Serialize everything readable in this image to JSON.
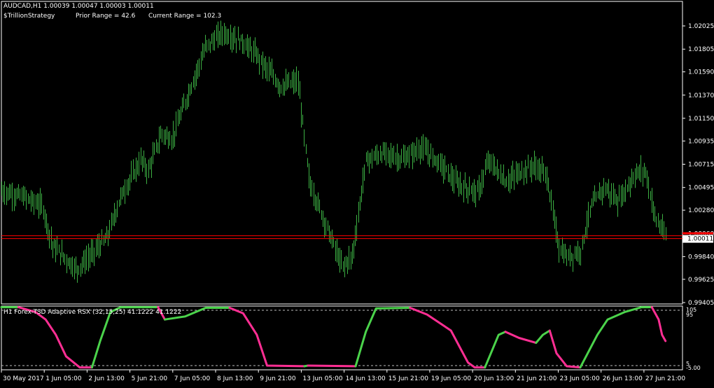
{
  "colors": {
    "background": "#000000",
    "frame": "#ffffff",
    "candle": "#3cb043",
    "level_line": "#ff0000",
    "rsx_up": "#4bd34b",
    "rsx_down": "#ff2e93",
    "level_dash": "#bbbbbb"
  },
  "header": {
    "symbol_line": "AUDCAD,H1  1.00039 1.00047 1.00003 1.00011",
    "strategy": "$TrillionStrategy",
    "prior_range": "Prior Range = 42.6",
    "current_range": "Current Range = 102.3"
  },
  "price_axis": {
    "ticks": [
      "1.02025",
      "1.01805",
      "1.01590",
      "1.01370",
      "1.01150",
      "1.00935",
      "1.00715",
      "1.00495",
      "1.00280",
      "1.00060",
      "0.99840",
      "0.99625",
      "0.99405"
    ],
    "current_price": "1.00011"
  },
  "indicator": {
    "label": "H1 Forex-TSD Adaptive RSX (32,15,25) 41.1222 41.1222",
    "upper_level_label": "95",
    "upper_range_label": "105",
    "lower_level_label": "5",
    "lower_range_label": "-5.00"
  },
  "time_axis": {
    "labels": [
      "30 May 2017",
      "1 Jun 05:00",
      "2 Jun 13:00",
      "5 Jun 21:00",
      "7 Jun 05:00",
      "8 Jun 13:00",
      "9 Jun 21:00",
      "13 Jun 05:00",
      "14 Jun 13:00",
      "15 Jun 21:00",
      "19 Jun 05:00",
      "20 Jun 13:00",
      "21 Jun 21:00",
      "23 Jun 05:00",
      "26 Jun 13:00",
      "27 Jun 21:00"
    ]
  },
  "chart_data": [
    {
      "type": "line",
      "symbol": "AUDCAD",
      "timeframe": "H1",
      "ylim": [
        0.99405,
        1.0213
      ],
      "level": 1.00011,
      "x": [
        "30 May 2017",
        "1 Jun 05:00",
        "2 Jun 13:00",
        "5 Jun 21:00",
        "7 Jun 05:00",
        "8 Jun 13:00",
        "9 Jun 21:00",
        "13 Jun 05:00",
        "14 Jun 13:00",
        "15 Jun 21:00",
        "19 Jun 05:00",
        "20 Jun 13:00",
        "21 Jun 21:00",
        "23 Jun 05:00",
        "26 Jun 13:00",
        "27 Jun 21:00"
      ],
      "close_path": [
        [
          0,
          1.0046
        ],
        [
          0.03,
          1.0041
        ],
        [
          0.06,
          1.0032
        ],
        [
          0.075,
          0.9994
        ],
        [
          0.09,
          0.9985
        ],
        [
          0.11,
          0.9972
        ],
        [
          0.13,
          0.9985
        ],
        [
          0.155,
          1.0002
        ],
        [
          0.175,
          1.0041
        ],
        [
          0.205,
          1.0076
        ],
        [
          0.215,
          1.0065
        ],
        [
          0.235,
          1.0101
        ],
        [
          0.25,
          1.0095
        ],
        [
          0.275,
          1.014
        ],
        [
          0.3,
          1.0183
        ],
        [
          0.325,
          1.0196
        ],
        [
          0.355,
          1.0187
        ],
        [
          0.375,
          1.0174
        ],
        [
          0.41,
          1.0145
        ],
        [
          0.435,
          1.015
        ],
        [
          0.452,
          1.0054
        ],
        [
          0.47,
          1.0025
        ],
        [
          0.5,
          0.9974
        ],
        [
          0.515,
          0.9985
        ],
        [
          0.535,
          1.0075
        ],
        [
          0.56,
          1.0082
        ],
        [
          0.59,
          1.0076
        ],
        [
          0.615,
          1.0087
        ],
        [
          0.64,
          1.0075
        ],
        [
          0.67,
          1.0052
        ],
        [
          0.7,
          1.0045
        ],
        [
          0.715,
          1.0075
        ],
        [
          0.74,
          1.0055
        ],
        [
          0.765,
          1.0065
        ],
        [
          0.78,
          1.007
        ],
        [
          0.8,
          1.0062
        ],
        [
          0.818,
          0.9993
        ],
        [
          0.83,
          0.9983
        ],
        [
          0.85,
          0.999
        ],
        [
          0.865,
          1.0031
        ],
        [
          0.885,
          1.005
        ],
        [
          0.905,
          1.0036
        ],
        [
          0.93,
          1.0062
        ],
        [
          0.945,
          1.0066
        ],
        [
          0.96,
          1.002
        ],
        [
          0.975,
          1.0003
        ]
      ]
    },
    {
      "type": "line",
      "title": "H1 Forex-TSD Adaptive RSX (32,15,25) 41.1222 41.1222",
      "ylim": [
        -5,
        105
      ],
      "levels": [
        95,
        5
      ],
      "x": [
        "30 May 2017",
        "1 Jun 05:00",
        "2 Jun 13:00",
        "5 Jun 21:00",
        "7 Jun 05:00",
        "8 Jun 13:00",
        "9 Jun 21:00",
        "13 Jun 05:00",
        "14 Jun 13:00",
        "15 Jun 21:00",
        "19 Jun 05:00",
        "20 Jun 13:00",
        "21 Jun 21:00",
        "23 Jun 05:00",
        "26 Jun 13:00",
        "27 Jun 21:00"
      ],
      "series": [
        {
          "trend": "up",
          "points": [
            [
              0,
              100
            ],
            [
              0.025,
              100
            ]
          ]
        },
        {
          "trend": "down",
          "points": [
            [
              0.025,
              100
            ],
            [
              0.05,
              92
            ],
            [
              0.065,
              80
            ],
            [
              0.08,
              55
            ],
            [
              0.095,
              20
            ],
            [
              0.115,
              2
            ],
            [
              0.133,
              2
            ]
          ]
        },
        {
          "trend": "up",
          "points": [
            [
              0.133,
              2
            ],
            [
              0.145,
              45
            ],
            [
              0.16,
              92
            ],
            [
              0.175,
              100
            ],
            [
              0.23,
              100
            ]
          ]
        },
        {
          "trend": "down",
          "points": [
            [
              0.23,
              100
            ],
            [
              0.24,
              80
            ]
          ]
        },
        {
          "trend": "up",
          "points": [
            [
              0.24,
              80
            ],
            [
              0.27,
              85
            ],
            [
              0.3,
              99
            ],
            [
              0.335,
              99
            ]
          ]
        },
        {
          "trend": "down",
          "points": [
            [
              0.335,
              99
            ],
            [
              0.355,
              90
            ],
            [
              0.375,
              55
            ],
            [
              0.39,
              5
            ],
            [
              0.445,
              4
            ]
          ]
        },
        {
          "trend": "up",
          "points": [
            [
              0.445,
              4
            ],
            [
              0.45,
              5
            ]
          ]
        },
        {
          "trend": "down",
          "points": [
            [
              0.45,
              5
            ],
            [
              0.52,
              4
            ]
          ]
        },
        {
          "trend": "up",
          "points": [
            [
              0.52,
              4
            ],
            [
              0.535,
              60
            ],
            [
              0.55,
              98
            ],
            [
              0.6,
              99
            ]
          ]
        },
        {
          "trend": "down",
          "points": [
            [
              0.6,
              99
            ],
            [
              0.625,
              88
            ],
            [
              0.66,
              62
            ],
            [
              0.685,
              10
            ],
            [
              0.695,
              2
            ],
            [
              0.71,
              2
            ]
          ]
        },
        {
          "trend": "up",
          "points": [
            [
              0.71,
              2
            ],
            [
              0.73,
              55
            ],
            [
              0.74,
              60
            ]
          ]
        },
        {
          "trend": "down",
          "points": [
            [
              0.74,
              60
            ],
            [
              0.76,
              50
            ],
            [
              0.785,
              42
            ]
          ]
        },
        {
          "trend": "up",
          "points": [
            [
              0.785,
              42
            ],
            [
              0.795,
              55
            ],
            [
              0.805,
              62
            ]
          ]
        },
        {
          "trend": "down",
          "points": [
            [
              0.805,
              62
            ],
            [
              0.815,
              25
            ],
            [
              0.83,
              4
            ],
            [
              0.85,
              2
            ]
          ]
        },
        {
          "trend": "up",
          "points": [
            [
              0.85,
              2
            ],
            [
              0.875,
              55
            ],
            [
              0.89,
              80
            ],
            [
              0.915,
              92
            ],
            [
              0.94,
              100
            ],
            [
              0.955,
              100
            ]
          ]
        },
        {
          "trend": "down",
          "points": [
            [
              0.955,
              100
            ],
            [
              0.965,
              80
            ],
            [
              0.97,
              55
            ],
            [
              0.975,
              45
            ]
          ]
        }
      ]
    }
  ]
}
